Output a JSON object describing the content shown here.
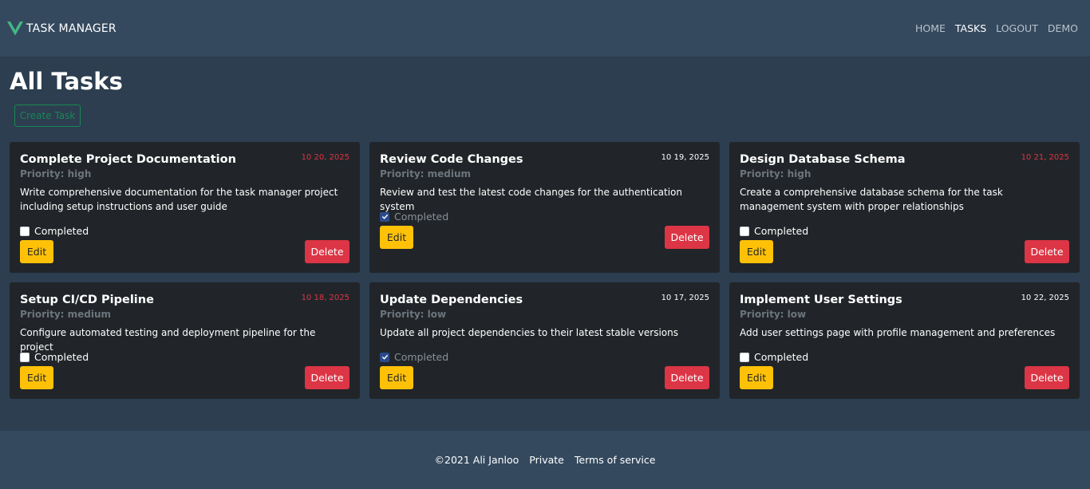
{
  "navbar": {
    "brand": "TASK MANAGER",
    "links": [
      {
        "label": "HOME"
      },
      {
        "label": "TASKS"
      },
      {
        "label": "LOGOUT"
      },
      {
        "label": "DEMO"
      }
    ]
  },
  "page": {
    "title": "All Tasks",
    "create_button": "Create Task"
  },
  "tasks": [
    {
      "title": "Complete Project Documentation",
      "date": "10 20, 2025",
      "overdue": true,
      "priority": "Priority: high",
      "description": "Write comprehensive documentation for the task manager project including setup instructions and user guide",
      "completed_label": "Completed",
      "completed": false,
      "edit": "Edit",
      "delete": "Delete"
    },
    {
      "title": "Review Code Changes",
      "date": "10 19, 2025",
      "overdue": false,
      "priority": "Priority: medium",
      "description": "Review and test the latest code changes for the authentication system",
      "completed_label": "Completed",
      "completed": true,
      "edit": "Edit",
      "delete": "Delete"
    },
    {
      "title": "Design Database Schema",
      "date": "10 21, 2025",
      "overdue": true,
      "priority": "Priority: high",
      "description": "Create a comprehensive database schema for the task management system with proper relationships",
      "completed_label": "Completed",
      "completed": false,
      "edit": "Edit",
      "delete": "Delete"
    },
    {
      "title": "Setup CI/CD Pipeline",
      "date": "10 18, 2025",
      "overdue": true,
      "priority": "Priority: medium",
      "description": "Configure automated testing and deployment pipeline for the project",
      "completed_label": "Completed",
      "completed": false,
      "edit": "Edit",
      "delete": "Delete"
    },
    {
      "title": "Update Dependencies",
      "date": "10 17, 2025",
      "overdue": false,
      "priority": "Priority: low",
      "description": "Update all project dependencies to their latest stable versions",
      "completed_label": "Completed",
      "completed": true,
      "edit": "Edit",
      "delete": "Delete"
    },
    {
      "title": "Implement User Settings",
      "date": "10 22, 2025",
      "overdue": false,
      "priority": "Priority: low",
      "description": "Add user settings page with profile management and preferences",
      "completed_label": "Completed",
      "completed": false,
      "edit": "Edit",
      "delete": "Delete"
    }
  ],
  "footer": {
    "copyright": "©2021 Ali Janloo",
    "private": "Private",
    "terms": "Terms of service"
  },
  "colors": {
    "background": "#2c3e50",
    "navbar": "#34495e",
    "card": "#212529",
    "warning": "#ffc107",
    "danger": "#dc3545",
    "success": "#198754",
    "brand_logo": "#41b883"
  }
}
